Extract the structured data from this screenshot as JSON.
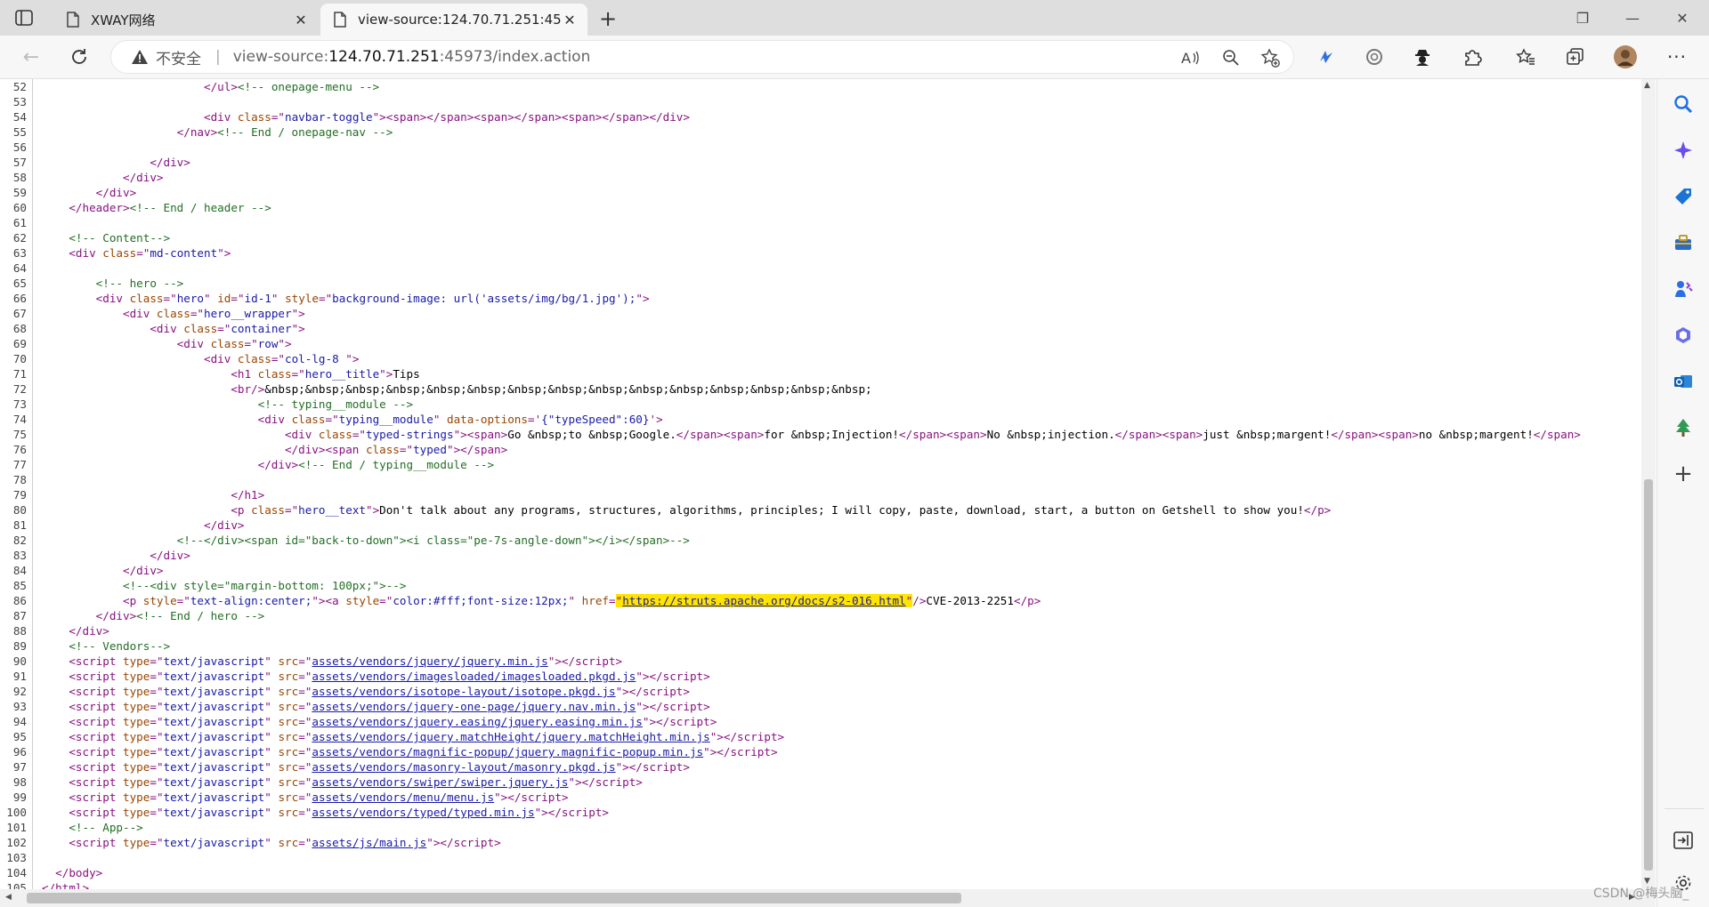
{
  "tabs": [
    {
      "title": "XWAY网络",
      "active": false
    },
    {
      "title": "view-source:124.70.71.251:45973/index.action",
      "active": true
    }
  ],
  "address": {
    "security_label": "不安全",
    "separator": "|",
    "prefix": "view-source:",
    "host": "124.70.71.251",
    "path": ":45973/index.action"
  },
  "watermark": "CSDN @梅头脑_",
  "source_lines": [
    {
      "n": "52",
      "html": "                        <span class=\"t\">&lt;/ul&gt;</span><span class=\"c\">&lt;!-- onepage-menu --&gt;</span>"
    },
    {
      "n": "53",
      "html": ""
    },
    {
      "n": "54",
      "html": "                        <span class=\"t\">&lt;div </span><span class=\"a\">class</span><span class=\"t\">=\"</span><span class=\"v\">navbar-toggle</span><span class=\"t\">\"&gt;&lt;span&gt;&lt;/span&gt;&lt;span&gt;&lt;/span&gt;&lt;span&gt;&lt;/span&gt;&lt;/div&gt;</span>"
    },
    {
      "n": "55",
      "html": "                    <span class=\"t\">&lt;/nav&gt;</span><span class=\"c\">&lt;!-- End / onepage-nav --&gt;</span>"
    },
    {
      "n": "56",
      "html": ""
    },
    {
      "n": "57",
      "html": "                <span class=\"t\">&lt;/div&gt;</span>"
    },
    {
      "n": "58",
      "html": "            <span class=\"t\">&lt;/div&gt;</span>"
    },
    {
      "n": "59",
      "html": "        <span class=\"t\">&lt;/div&gt;</span>"
    },
    {
      "n": "60",
      "html": "    <span class=\"t\">&lt;/header&gt;</span><span class=\"c\">&lt;!-- End / header --&gt;</span>"
    },
    {
      "n": "61",
      "html": ""
    },
    {
      "n": "62",
      "html": "    <span class=\"c\">&lt;!-- Content--&gt;</span>"
    },
    {
      "n": "63",
      "html": "    <span class=\"t\">&lt;div </span><span class=\"a\">class</span><span class=\"t\">=\"</span><span class=\"v\">md-content</span><span class=\"t\">\"&gt;</span>"
    },
    {
      "n": "64",
      "html": ""
    },
    {
      "n": "65",
      "html": "        <span class=\"c\">&lt;!-- hero --&gt;</span>"
    },
    {
      "n": "66",
      "html": "        <span class=\"t\">&lt;div </span><span class=\"a\">class</span><span class=\"t\">=\"</span><span class=\"v\">hero</span><span class=\"t\">\" </span><span class=\"a\">id</span><span class=\"t\">=\"</span><span class=\"v\">id-1</span><span class=\"t\">\" </span><span class=\"a\">style</span><span class=\"t\">=\"</span><span class=\"v\">background-image: url('assets/img/bg/1.jpg');</span><span class=\"t\">\"&gt;</span>"
    },
    {
      "n": "67",
      "html": "            <span class=\"t\">&lt;div </span><span class=\"a\">class</span><span class=\"t\">=\"</span><span class=\"v\">hero__wrapper</span><span class=\"t\">\"&gt;</span>"
    },
    {
      "n": "68",
      "html": "                <span class=\"t\">&lt;div </span><span class=\"a\">class</span><span class=\"t\">=\"</span><span class=\"v\">container</span><span class=\"t\">\"&gt;</span>"
    },
    {
      "n": "69",
      "html": "                    <span class=\"t\">&lt;div </span><span class=\"a\">class</span><span class=\"t\">=\"</span><span class=\"v\">row</span><span class=\"t\">\"&gt;</span>"
    },
    {
      "n": "70",
      "html": "                        <span class=\"t\">&lt;div </span><span class=\"a\">class</span><span class=\"t\">=\"</span><span class=\"v\">col-lg-8 </span><span class=\"t\">\"&gt;</span>"
    },
    {
      "n": "71",
      "html": "                            <span class=\"t\">&lt;h1 </span><span class=\"a\">class</span><span class=\"t\">=\"</span><span class=\"v\">hero__title</span><span class=\"t\">\"&gt;</span><span class=\"tx\">Tips</span>"
    },
    {
      "n": "72",
      "html": "                            <span class=\"t\">&lt;br/&gt;</span><span class=\"tx\">&amp;nbsp;&amp;nbsp;&amp;nbsp;&amp;nbsp;&amp;nbsp;&amp;nbsp;&amp;nbsp;&amp;nbsp;&amp;nbsp;&amp;nbsp;&amp;nbsp;&amp;nbsp;&amp;nbsp;&amp;nbsp;&amp;nbsp;</span>"
    },
    {
      "n": "73",
      "html": "                                <span class=\"c\">&lt;!-- typing__module --&gt;</span>"
    },
    {
      "n": "74",
      "html": "                                <span class=\"t\">&lt;div </span><span class=\"a\">class</span><span class=\"t\">=\"</span><span class=\"v\">typing__module</span><span class=\"t\">\" </span><span class=\"a\">data-options</span><span class=\"t\">='</span><span class=\"v\">{\"typeSpeed\":60}</span><span class=\"t\">'&gt;</span>"
    },
    {
      "n": "75",
      "html": "                                    <span class=\"t\">&lt;div </span><span class=\"a\">class</span><span class=\"t\">=\"</span><span class=\"v\">typed-strings</span><span class=\"t\">\"&gt;&lt;span&gt;</span><span class=\"tx\">Go &amp;nbsp;to &amp;nbsp;Google.</span><span class=\"t\">&lt;/span&gt;&lt;span&gt;</span><span class=\"tx\">for &amp;nbsp;Injection!</span><span class=\"t\">&lt;/span&gt;&lt;span&gt;</span><span class=\"tx\">No &amp;nbsp;injection.</span><span class=\"t\">&lt;/span&gt;&lt;span&gt;</span><span class=\"tx\">just &amp;nbsp;margent!</span><span class=\"t\">&lt;/span&gt;&lt;span&gt;</span><span class=\"tx\">no &amp;nbsp;margent!</span><span class=\"t\">&lt;/span&gt;</span>"
    },
    {
      "n": "76",
      "html": "                                    <span class=\"t\">&lt;/div&gt;&lt;span </span><span class=\"a\">class</span><span class=\"t\">=\"</span><span class=\"v\">typed</span><span class=\"t\">\"&gt;&lt;/span&gt;</span>"
    },
    {
      "n": "77",
      "html": "                                <span class=\"t\">&lt;/div&gt;</span><span class=\"c\">&lt;!-- End / typing__module --&gt;</span>"
    },
    {
      "n": "78",
      "html": ""
    },
    {
      "n": "79",
      "html": "                            <span class=\"t\">&lt;/h1&gt;</span>"
    },
    {
      "n": "80",
      "html": "                            <span class=\"t\">&lt;p </span><span class=\"a\">class</span><span class=\"t\">=\"</span><span class=\"v\">hero__text</span><span class=\"t\">\"&gt;</span><span class=\"tx\">Don't talk about any programs, structures, algorithms, principles; I will copy, paste, download, start, a button on Getshell to show you!</span><span class=\"t\">&lt;/p&gt;</span>"
    },
    {
      "n": "81",
      "html": "                        <span class=\"t\">&lt;/div&gt;</span>"
    },
    {
      "n": "82",
      "html": "                    <span class=\"c\">&lt;!--&lt;/div&gt;&lt;span id=\"back-to-down\"&gt;&lt;i class=\"pe-7s-angle-down\"&gt;&lt;/i&gt;&lt;/span&gt;--&gt;</span>"
    },
    {
      "n": "83",
      "html": "                <span class=\"t\">&lt;/div&gt;</span>"
    },
    {
      "n": "84",
      "html": "            <span class=\"t\">&lt;/div&gt;</span>"
    },
    {
      "n": "85",
      "html": "            <span class=\"c\">&lt;!--&lt;div style=\"margin-bottom: 100px;\"&gt;--&gt;</span>"
    },
    {
      "n": "86",
      "html": "            <span class=\"t\">&lt;p </span><span class=\"a\">style</span><span class=\"t\">=\"</span><span class=\"v\">text-align:center;</span><span class=\"t\">\"&gt;&lt;a </span><span class=\"a\">style</span><span class=\"t\">=\"</span><span class=\"v\">color:#fff;font-size:12px;</span><span class=\"t\">\" </span><span class=\"a\">href</span><span class=\"t\">=</span><span class=\"hl\"><span class=\"t\">\"</span><span class=\"lk\">https://struts.apache.org/docs/s2-016.html</span><span class=\"t\">\"</span></span><span class=\"t\">/&gt;</span><span class=\"tx\">CVE-2013-2251</span><span class=\"t\">&lt;/p&gt;</span>"
    },
    {
      "n": "87",
      "html": "        <span class=\"t\">&lt;/div&gt;</span><span class=\"c\">&lt;!-- End / hero --&gt;</span>"
    },
    {
      "n": "88",
      "html": "    <span class=\"t\">&lt;/div&gt;</span>"
    },
    {
      "n": "89",
      "html": "    <span class=\"c\">&lt;!-- Vendors--&gt;</span>"
    },
    {
      "n": "90",
      "html": "    <span class=\"t\">&lt;script </span><span class=\"a\">type</span><span class=\"t\">=\"</span><span class=\"v\">text/javascript</span><span class=\"t\">\" </span><span class=\"a\">src</span><span class=\"t\">=\"</span><span class=\"lk\">assets/vendors/jquery/jquery.min.js</span><span class=\"t\">\"&gt;&lt;/script&gt;</span>"
    },
    {
      "n": "91",
      "html": "    <span class=\"t\">&lt;script </span><span class=\"a\">type</span><span class=\"t\">=\"</span><span class=\"v\">text/javascript</span><span class=\"t\">\" </span><span class=\"a\">src</span><span class=\"t\">=\"</span><span class=\"lk\">assets/vendors/imagesloaded/imagesloaded.pkgd.js</span><span class=\"t\">\"&gt;&lt;/script&gt;</span>"
    },
    {
      "n": "92",
      "html": "    <span class=\"t\">&lt;script </span><span class=\"a\">type</span><span class=\"t\">=\"</span><span class=\"v\">text/javascript</span><span class=\"t\">\" </span><span class=\"a\">src</span><span class=\"t\">=\"</span><span class=\"lk\">assets/vendors/isotope-layout/isotope.pkgd.js</span><span class=\"t\">\"&gt;&lt;/script&gt;</span>"
    },
    {
      "n": "93",
      "html": "    <span class=\"t\">&lt;script </span><span class=\"a\">type</span><span class=\"t\">=\"</span><span class=\"v\">text/javascript</span><span class=\"t\">\" </span><span class=\"a\">src</span><span class=\"t\">=\"</span><span class=\"lk\">assets/vendors/jquery-one-page/jquery.nav.min.js</span><span class=\"t\">\"&gt;&lt;/script&gt;</span>"
    },
    {
      "n": "94",
      "html": "    <span class=\"t\">&lt;script </span><span class=\"a\">type</span><span class=\"t\">=\"</span><span class=\"v\">text/javascript</span><span class=\"t\">\" </span><span class=\"a\">src</span><span class=\"t\">=\"</span><span class=\"lk\">assets/vendors/jquery.easing/jquery.easing.min.js</span><span class=\"t\">\"&gt;&lt;/script&gt;</span>"
    },
    {
      "n": "95",
      "html": "    <span class=\"t\">&lt;script </span><span class=\"a\">type</span><span class=\"t\">=\"</span><span class=\"v\">text/javascript</span><span class=\"t\">\" </span><span class=\"a\">src</span><span class=\"t\">=\"</span><span class=\"lk\">assets/vendors/jquery.matchHeight/jquery.matchHeight.min.js</span><span class=\"t\">\"&gt;&lt;/script&gt;</span>"
    },
    {
      "n": "96",
      "html": "    <span class=\"t\">&lt;script </span><span class=\"a\">type</span><span class=\"t\">=\"</span><span class=\"v\">text/javascript</span><span class=\"t\">\" </span><span class=\"a\">src</span><span class=\"t\">=\"</span><span class=\"lk\">assets/vendors/magnific-popup/jquery.magnific-popup.min.js</span><span class=\"t\">\"&gt;&lt;/script&gt;</span>"
    },
    {
      "n": "97",
      "html": "    <span class=\"t\">&lt;script </span><span class=\"a\">type</span><span class=\"t\">=\"</span><span class=\"v\">text/javascript</span><span class=\"t\">\" </span><span class=\"a\">src</span><span class=\"t\">=\"</span><span class=\"lk\">assets/vendors/masonry-layout/masonry.pkgd.js</span><span class=\"t\">\"&gt;&lt;/script&gt;</span>"
    },
    {
      "n": "98",
      "html": "    <span class=\"t\">&lt;script </span><span class=\"a\">type</span><span class=\"t\">=\"</span><span class=\"v\">text/javascript</span><span class=\"t\">\" </span><span class=\"a\">src</span><span class=\"t\">=\"</span><span class=\"lk\">assets/vendors/swiper/swiper.jquery.js</span><span class=\"t\">\"&gt;&lt;/script&gt;</span>"
    },
    {
      "n": "99",
      "html": "    <span class=\"t\">&lt;script </span><span class=\"a\">type</span><span class=\"t\">=\"</span><span class=\"v\">text/javascript</span><span class=\"t\">\" </span><span class=\"a\">src</span><span class=\"t\">=\"</span><span class=\"lk\">assets/vendors/menu/menu.js</span><span class=\"t\">\"&gt;&lt;/script&gt;</span>"
    },
    {
      "n": "100",
      "html": "    <span class=\"t\">&lt;script </span><span class=\"a\">type</span><span class=\"t\">=\"</span><span class=\"v\">text/javascript</span><span class=\"t\">\" </span><span class=\"a\">src</span><span class=\"t\">=\"</span><span class=\"lk\">assets/vendors/typed/typed.min.js</span><span class=\"t\">\"&gt;&lt;/script&gt;</span>"
    },
    {
      "n": "101",
      "html": "    <span class=\"c\">&lt;!-- App--&gt;</span>"
    },
    {
      "n": "102",
      "html": "    <span class=\"t\">&lt;script </span><span class=\"a\">type</span><span class=\"t\">=\"</span><span class=\"v\">text/javascript</span><span class=\"t\">\" </span><span class=\"a\">src</span><span class=\"t\">=\"</span><span class=\"lk\">assets/js/main.js</span><span class=\"t\">\"&gt;&lt;/script&gt;</span>"
    },
    {
      "n": "103",
      "html": ""
    },
    {
      "n": "104",
      "html": "  <span class=\"t\">&lt;/body&gt;</span>"
    },
    {
      "n": "105",
      "html": "<span class=\"t\">&lt;/html&gt;</span>"
    }
  ],
  "icons": {
    "toolbar": [
      "read-aloud-icon",
      "zoom-out-icon",
      "favorite-add-icon",
      "extension-blue-icon",
      "copilot-ring-icon",
      "profile-spy-icon",
      "extensions-icon",
      "favorites-icon",
      "collections-icon",
      "avatar",
      "more-icon"
    ],
    "sidebar": [
      "search-icon",
      "copilot-icon",
      "shopping-tag-icon",
      "tools-icon",
      "games-icon",
      "office-icon",
      "outlook-icon",
      "tree-icon",
      "add-icon",
      "split-screen-icon",
      "settings-icon"
    ]
  },
  "colors": {
    "tag": "#881280",
    "attr_name": "#994500",
    "attr_value": "#1a1aa6",
    "comment": "#236e25",
    "highlight": "#ffe500"
  }
}
